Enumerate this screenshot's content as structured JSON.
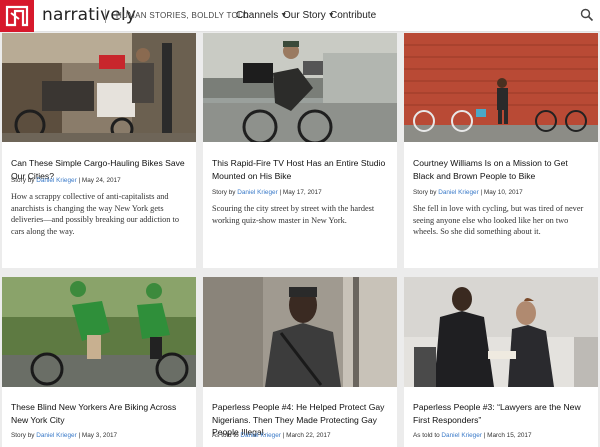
{
  "header": {
    "logo_text": "narratively",
    "tagline": "HUMAN STORIES, BOLDLY TOLD",
    "nav": [
      {
        "label": "Channels",
        "has_dropdown": true
      },
      {
        "label": "Our Story",
        "has_dropdown": true
      },
      {
        "label": "Contribute",
        "has_dropdown": false
      }
    ]
  },
  "cards": [
    {
      "title": "Can These Simple Cargo-Hauling Bikes Save Our Cities?",
      "byline_prefix": "Story by ",
      "author": "Daniel Krieger",
      "date": " | May 24, 2017",
      "description": "How a scrappy collective of anti-capitalists and anarchists is changing the way New York gets deliveries—and possibly breaking our addiction to cars along the way."
    },
    {
      "title": "This Rapid-Fire TV Host Has an Entire Studio Mounted on His Bike",
      "byline_prefix": "Story by ",
      "author": "Daniel Krieger",
      "date": " | May 17, 2017",
      "description": "Scouring the city street by street with the hardest working quiz-show master in New York."
    },
    {
      "title": "Courtney Williams Is on a Mission to Get Black and Brown People to Bike",
      "byline_prefix": "Story by ",
      "author": "Daniel Krieger",
      "date": " | May 10, 2017",
      "description": "She fell in love with cycling, but was tired of never seeing anyone else who looked like her on two wheels. So she did something about it."
    },
    {
      "title": "These Blind New Yorkers Are Biking Across New York City",
      "byline_prefix": "Story by ",
      "author": "Daniel Krieger",
      "date": " | May 3, 2017",
      "description": ""
    },
    {
      "title": "Paperless People #4: He Helped Protect Gay Nigerians. Then They Made Protecting Gay People Illegal.",
      "byline_prefix": "As told to ",
      "author": "Daniel Krieger",
      "date": " | March 22, 2017",
      "description": ""
    },
    {
      "title": "Paperless People #3: “Lawyers are the New First Responders”",
      "byline_prefix": "As told to ",
      "author": "Daniel Krieger",
      "date": " | March 15, 2017",
      "description": ""
    }
  ],
  "colors": {
    "brand": "#d7192c",
    "author_link": "#3a7ac8",
    "page_bg": "#ececec"
  }
}
